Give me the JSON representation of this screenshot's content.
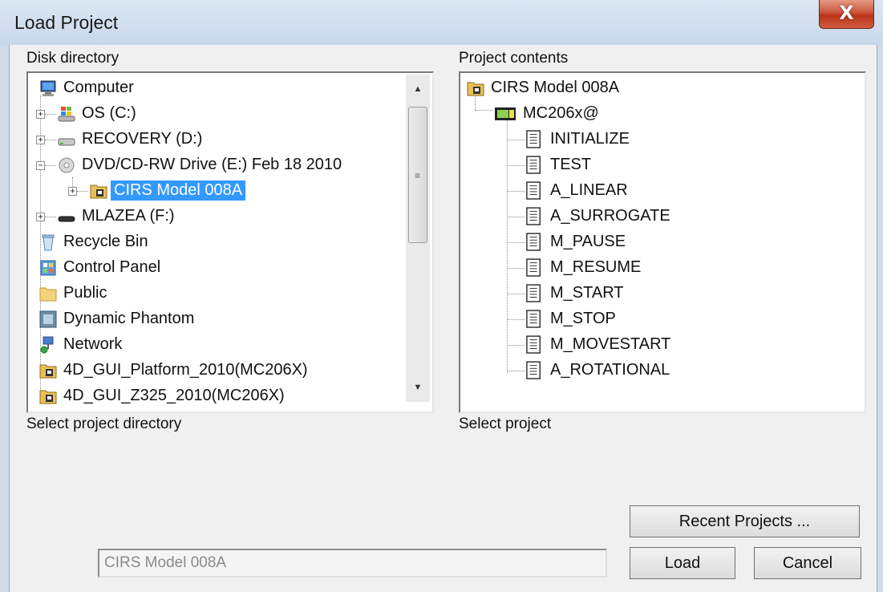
{
  "window": {
    "title": "Load Project"
  },
  "labels": {
    "disk_directory": "Disk directory",
    "project_contents": "Project contents",
    "select_project_directory": "Select project directory",
    "select_project": "Select project"
  },
  "directory_tree": [
    {
      "label": "Computer",
      "icon": "computer-icon",
      "expander": ""
    },
    {
      "label": "OS (C:)",
      "icon": "windows-drive-icon",
      "expander": "+"
    },
    {
      "label": "RECOVERY (D:)",
      "icon": "hard-drive-icon",
      "expander": "+"
    },
    {
      "label": "DVD/CD-RW Drive (E:) Feb 18 2010",
      "icon": "dvd-drive-icon",
      "expander": "−"
    },
    {
      "label": "CIRS Model 008A",
      "icon": "project-folder-icon",
      "expander": "+",
      "selected": true
    },
    {
      "label": "MLAZEA (F:)",
      "icon": "removable-drive-icon",
      "expander": "+"
    },
    {
      "label": "Recycle Bin",
      "icon": "recycle-bin-icon",
      "expander": ""
    },
    {
      "label": "Control Panel",
      "icon": "control-panel-icon",
      "expander": ""
    },
    {
      "label": "Public",
      "icon": "folder-icon",
      "expander": ""
    },
    {
      "label": "Dynamic Phantom",
      "icon": "application-icon",
      "expander": ""
    },
    {
      "label": "Network",
      "icon": "network-icon",
      "expander": ""
    },
    {
      "label": "4D_GUI_Platform_2010(MC206X)",
      "icon": "project-folder-icon",
      "expander": ""
    },
    {
      "label": "4D_GUI_Z325_2010(MC206X)",
      "icon": "project-folder-icon",
      "expander": ""
    }
  ],
  "project_tree": {
    "root": "CIRS Model 008A",
    "controller": "MC206x@",
    "programs": [
      "INITIALIZE",
      "TEST",
      "A_LINEAR",
      "A_SURROGATE",
      "M_PAUSE",
      "M_RESUME",
      "M_START",
      "M_STOP",
      "M_MOVESTART",
      "A_ROTATIONAL"
    ]
  },
  "project_path_field": {
    "value": "CIRS Model 008A"
  },
  "buttons": {
    "recent": "Recent Projects ...",
    "load": "Load",
    "cancel": "Cancel",
    "close": "X"
  },
  "colors": {
    "selection": "#3399ff",
    "close_button": "#c9543b"
  }
}
